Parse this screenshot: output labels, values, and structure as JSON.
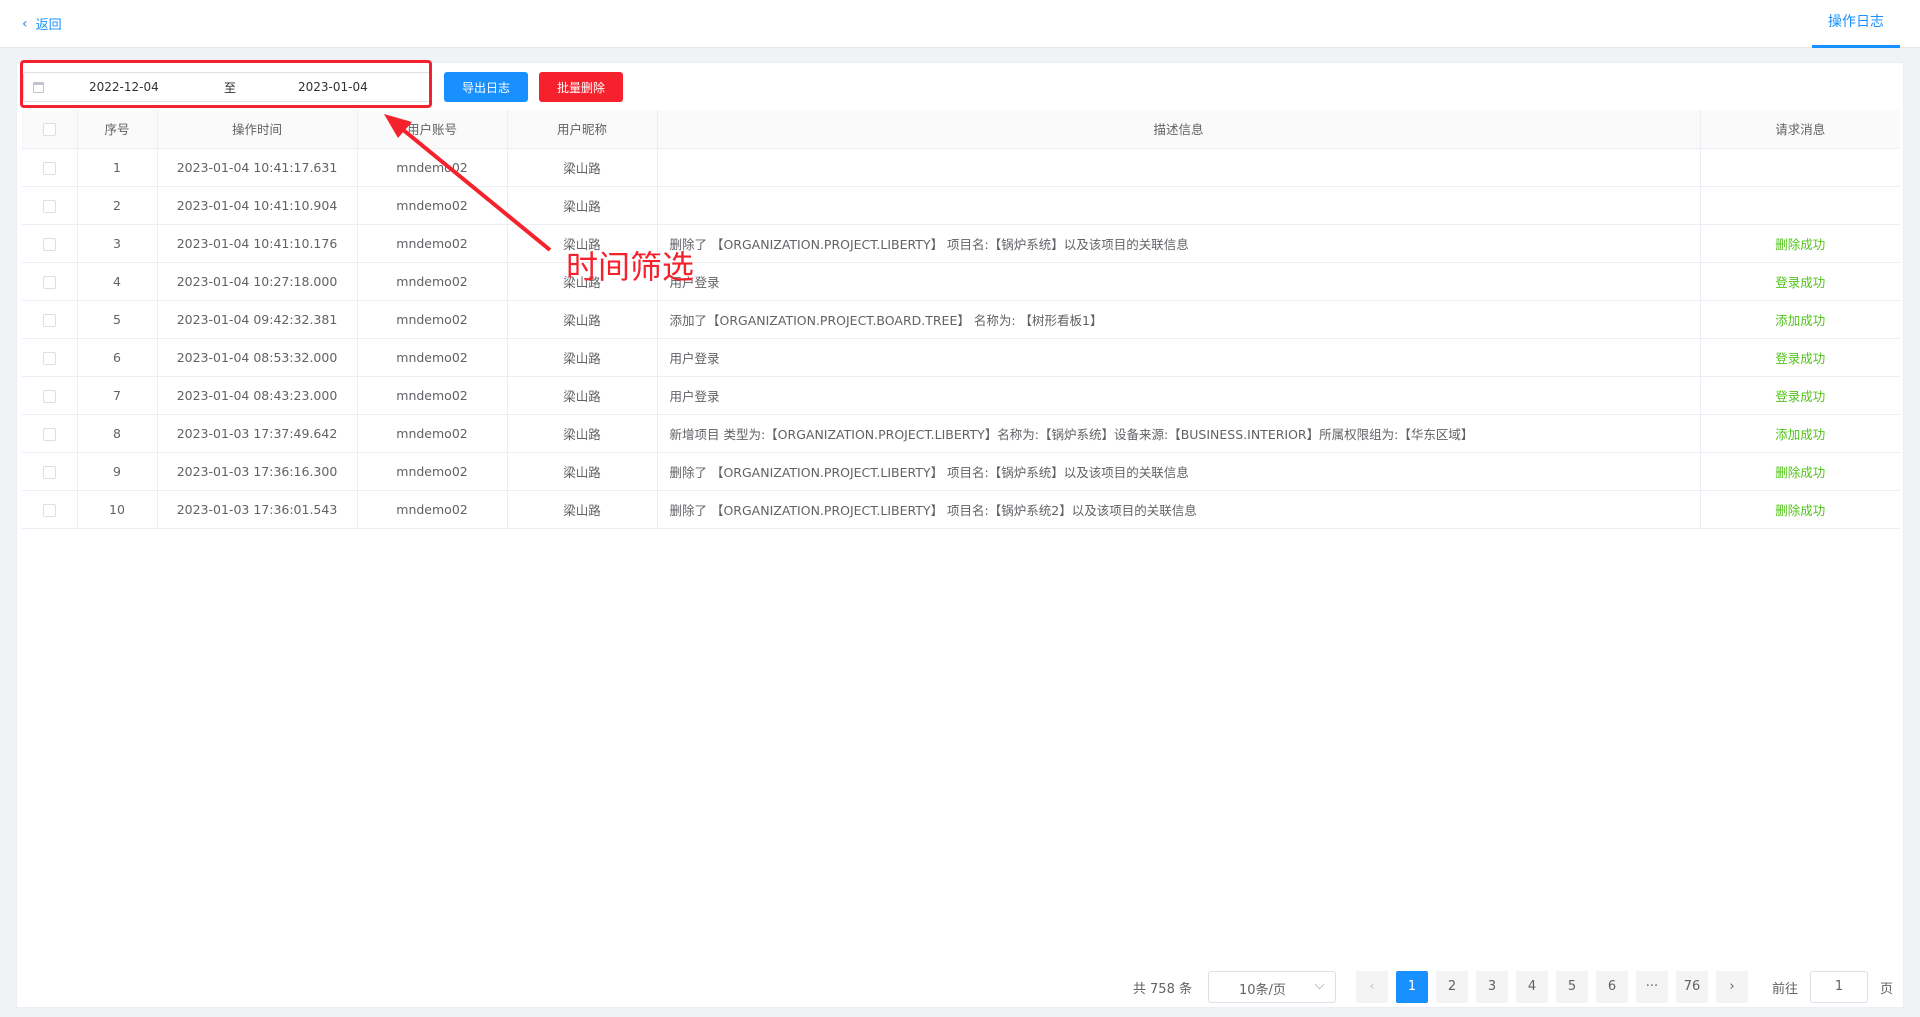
{
  "header": {
    "back_label": "返回",
    "tab_label": "操作日志"
  },
  "toolbar": {
    "start_date": "2022-12-04",
    "separator": "至",
    "end_date": "2023-01-04",
    "export_label": "导出日志",
    "delete_label": "批量删除"
  },
  "annotation": {
    "text": "时间筛选"
  },
  "table": {
    "columns": [
      "序号",
      "操作时间",
      "用户账号",
      "用户昵称",
      "描述信息",
      "请求消息"
    ],
    "rows": [
      {
        "no": "1",
        "time": "2023-01-04 10:41:17.631",
        "account": "mndemo02",
        "nick": "梁山路",
        "desc": "",
        "msg": ""
      },
      {
        "no": "2",
        "time": "2023-01-04 10:41:10.904",
        "account": "mndemo02",
        "nick": "梁山路",
        "desc": "",
        "msg": ""
      },
      {
        "no": "3",
        "time": "2023-01-04 10:41:10.176",
        "account": "mndemo02",
        "nick": "梁山路",
        "desc": "删除了 【ORGANIZATION.PROJECT.LIBERTY】 项目名:【锅炉系统】以及该项目的关联信息",
        "msg": "删除成功"
      },
      {
        "no": "4",
        "time": "2023-01-04 10:27:18.000",
        "account": "mndemo02",
        "nick": "梁山路",
        "desc": "用户登录",
        "msg": "登录成功"
      },
      {
        "no": "5",
        "time": "2023-01-04 09:42:32.381",
        "account": "mndemo02",
        "nick": "梁山路",
        "desc": "添加了【ORGANIZATION.PROJECT.BOARD.TREE】 名称为: 【树形看板1】",
        "msg": "添加成功"
      },
      {
        "no": "6",
        "time": "2023-01-04 08:53:32.000",
        "account": "mndemo02",
        "nick": "梁山路",
        "desc": "用户登录",
        "msg": "登录成功"
      },
      {
        "no": "7",
        "time": "2023-01-04 08:43:23.000",
        "account": "mndemo02",
        "nick": "梁山路",
        "desc": "用户登录",
        "msg": "登录成功"
      },
      {
        "no": "8",
        "time": "2023-01-03 17:37:49.642",
        "account": "mndemo02",
        "nick": "梁山路",
        "desc": "新增项目 类型为:【ORGANIZATION.PROJECT.LIBERTY】名称为:【锅炉系统】设备来源:【BUSINESS.INTERIOR】所属权限组为:【华东区域】",
        "msg": "添加成功"
      },
      {
        "no": "9",
        "time": "2023-01-03 17:36:16.300",
        "account": "mndemo02",
        "nick": "梁山路",
        "desc": "删除了 【ORGANIZATION.PROJECT.LIBERTY】 项目名:【锅炉系统】以及该项目的关联信息",
        "msg": "删除成功"
      },
      {
        "no": "10",
        "time": "2023-01-03 17:36:01.543",
        "account": "mndemo02",
        "nick": "梁山路",
        "desc": "删除了 【ORGANIZATION.PROJECT.LIBERTY】 项目名:【锅炉系统2】以及该项目的关联信息",
        "msg": "删除成功"
      }
    ]
  },
  "pagination": {
    "total_text": "共 758 条",
    "page_size": "10条/页",
    "pages": [
      "1",
      "2",
      "3",
      "4",
      "5",
      "6"
    ],
    "ellipsis": "···",
    "last_page": "76",
    "goto_prefix": "前往",
    "goto_value": "1",
    "goto_suffix": "页",
    "prev_icon": "‹",
    "next_icon": "›"
  },
  "colors": {
    "primary": "#1890ff",
    "danger": "#f5222d",
    "success": "#52c41a"
  }
}
